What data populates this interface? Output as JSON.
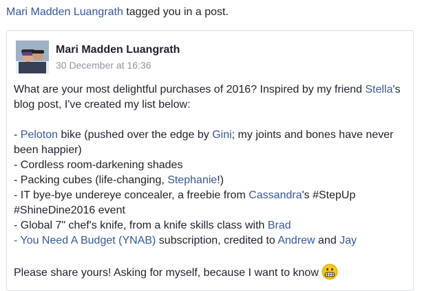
{
  "notification": {
    "actor": "Mari Madden Luangrath",
    "text": " tagged you in a post."
  },
  "post": {
    "author": "Mari Madden Luangrath",
    "timestamp": "30 December at 16:36",
    "intro": {
      "p1": "What are your most delightful purchases of 2016? Inspired by my friend ",
      "link1": "Stella",
      "p2": "'s blog post, I've created my list below:"
    },
    "items": {
      "i1_pre": "- ",
      "i1_link": "Peloton",
      "i1_mid": " bike (pushed over the edge by ",
      "i1_link2": "Gini",
      "i1_post": "; my joints and bones have never been happier)",
      "i2": "- Cordless room-darkening shades",
      "i3_pre": "- Packing cubes (life-changing, ",
      "i3_link": "Stephanie",
      "i3_post": "!)",
      "i4_pre": "- IT bye-bye undereye concealer, a freebie from ",
      "i4_link": "Cassandra",
      "i4_post": "'s #StepUp #ShineDine2016 event",
      "i5_pre": "- Global 7\" chef's knife, from a knife skills class with ",
      "i5_link": "Brad",
      "i6_link": "- You Need A Budget (YNAB)",
      "i6_mid": " subscription, credited to ",
      "i6_link2": "Andrew",
      "i6_and": " and ",
      "i6_link3": "Jay"
    },
    "closing": "Please share yours! Asking for myself, because I want to know",
    "emoji_icon": "grimacing-face-icon"
  }
}
